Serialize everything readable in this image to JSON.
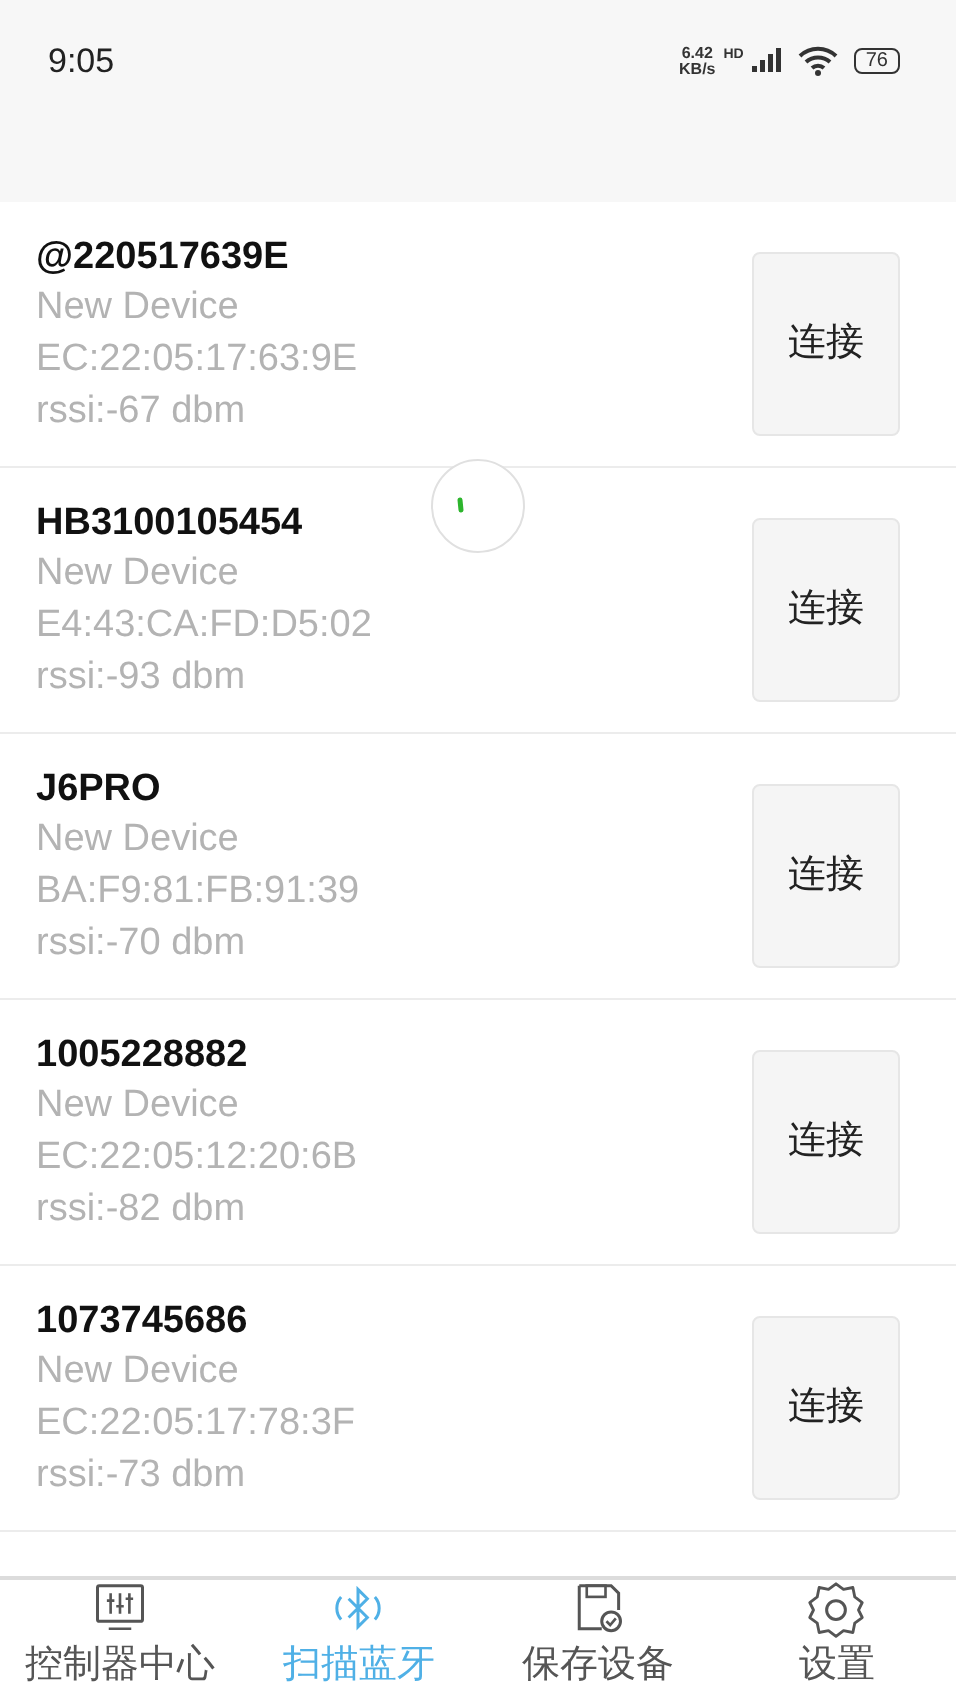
{
  "status_bar": {
    "time": "9:05",
    "net_speed": "6.42",
    "net_unit": "KB/s",
    "hd": "HD",
    "battery": "76"
  },
  "devices": [
    {
      "name": "@220517639E",
      "type": "New Device",
      "address": "EC:22:05:17:63:9E",
      "rssi": "rssi:-67 dbm",
      "button": "连接"
    },
    {
      "name": "HB3100105454",
      "type": "New Device",
      "address": "E4:43:CA:FD:D5:02",
      "rssi": "rssi:-93 dbm",
      "button": "连接"
    },
    {
      "name": "J6PRO",
      "type": "New Device",
      "address": "BA:F9:81:FB:91:39",
      "rssi": "rssi:-70 dbm",
      "button": "连接"
    },
    {
      "name": "1005228882",
      "type": "New Device",
      "address": "EC:22:05:12:20:6B",
      "rssi": "rssi:-82 dbm",
      "button": "连接"
    },
    {
      "name": "1073745686",
      "type": "New Device",
      "address": "EC:22:05:17:78:3F",
      "rssi": "rssi:-73 dbm",
      "button": "连接"
    }
  ],
  "tab_bar": [
    {
      "kind": "controller",
      "label": "控制器中心",
      "selected": false
    },
    {
      "kind": "bluetooth",
      "label": "扫描蓝牙",
      "selected": true
    },
    {
      "kind": "saved",
      "label": "保存设备",
      "selected": false
    },
    {
      "kind": "settings",
      "label": "设置",
      "selected": false
    }
  ]
}
